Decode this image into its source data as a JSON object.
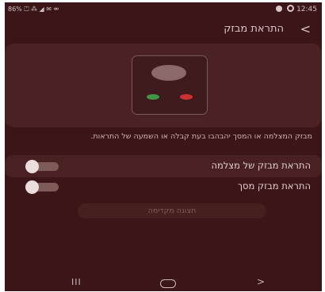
{
  "status_bar": {
    "left_text": "86% ⏍ ⁂ ◢ ✉ ⚮",
    "time": "12:45"
  },
  "header": {
    "back_label": "<",
    "title": "התראת מבזק"
  },
  "description": "מבזק המצלמה או המסך יהבהבו בעת קבלה או השמעה של התראות.",
  "settings": [
    {
      "label": "התראת מבזק של מצלמה",
      "enabled": false
    },
    {
      "label": "התראת מבזק מסך",
      "enabled": false
    }
  ],
  "preview_button": "תצוגה מקדימה",
  "nav_bar": {
    "recents_label": "III",
    "back_label": ">"
  },
  "colors": {
    "background": "#3b1517",
    "card": "#4a2224",
    "led_green": "#3c9a46",
    "led_red": "#d03030"
  }
}
